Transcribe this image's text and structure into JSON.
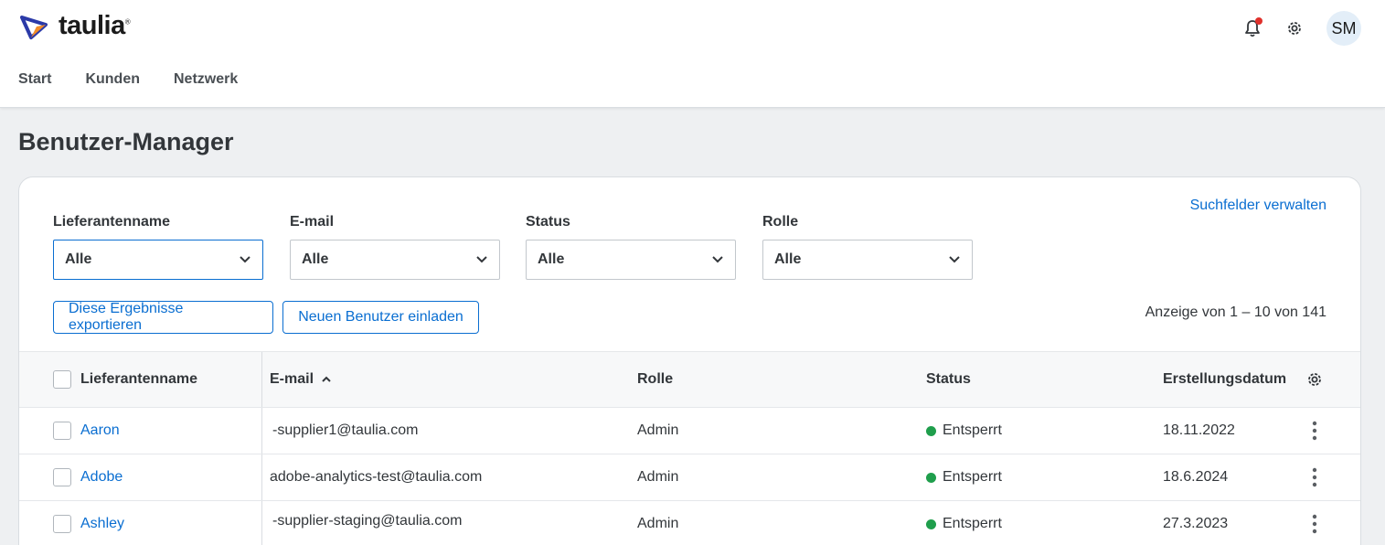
{
  "brand": {
    "name": "taulia",
    "reg": "®"
  },
  "nav": {
    "items": [
      {
        "label": "Start"
      },
      {
        "label": "Kunden"
      },
      {
        "label": "Netzwerk"
      }
    ]
  },
  "user": {
    "initials": "SM"
  },
  "page": {
    "title": "Benutzer-Manager"
  },
  "filters": {
    "manage_label": "Suchfelder verwalten",
    "fields": [
      {
        "label": "Lieferantenname",
        "value": "Alle"
      },
      {
        "label": "E-mail",
        "value": "Alle"
      },
      {
        "label": "Status",
        "value": "Alle"
      },
      {
        "label": "Rolle",
        "value": "Alle"
      }
    ]
  },
  "actions": {
    "export_label": "Diese Ergebnisse exportieren",
    "invite_label": "Neuen Benutzer einladen"
  },
  "results": {
    "count_text": "Anzeige von 1 – 10 von 141"
  },
  "table": {
    "headers": {
      "name": "Lieferantenname",
      "email": "E-mail",
      "role": "Rolle",
      "status": "Status",
      "created": "Erstellungsdatum"
    },
    "rows": [
      {
        "name": "Aaron",
        "email": "-supplier1@taulia.com",
        "role": "Admin",
        "status": "Entsperrt",
        "created": "18.11.2022"
      },
      {
        "name": "Adobe",
        "email": "adobe-analytics-test@taulia.com",
        "role": "Admin",
        "status": "Entsperrt",
        "created": "18.6.2024"
      },
      {
        "name": "Ashley",
        "email": "-supplier-staging@taulia.com",
        "role": "Admin",
        "status": "Entsperrt",
        "created": "27.3.2023"
      }
    ]
  },
  "colors": {
    "accent": "#0a6ed1",
    "status_unlocked": "#1f9e4c",
    "notification": "#e0302b"
  },
  "icons": {
    "bell": "bell-icon",
    "gear": "gear-icon",
    "chevron": "chevron-down-icon",
    "sort": "sort-asc-icon",
    "more": "more-vertical-icon"
  }
}
